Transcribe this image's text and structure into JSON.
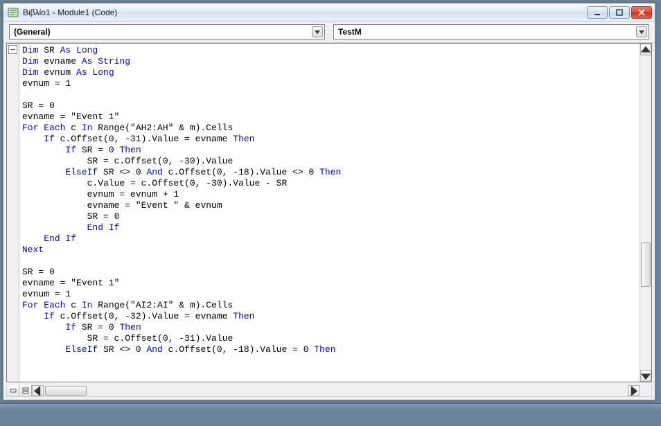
{
  "window": {
    "title": "Βιβλίο1 - Module1 (Code)"
  },
  "dropdowns": {
    "object": "(General)",
    "procedure": "TestM"
  },
  "code_tokens": [
    [
      [
        "kw",
        "Dim"
      ],
      [
        "",
        " SR "
      ],
      [
        "kw",
        "As Long"
      ]
    ],
    [
      [
        "kw",
        "Dim"
      ],
      [
        "",
        " evname "
      ],
      [
        "kw",
        "As String"
      ]
    ],
    [
      [
        "kw",
        "Dim"
      ],
      [
        "",
        " evnum "
      ],
      [
        "kw",
        "As Long"
      ]
    ],
    [
      [
        "",
        "evnum = 1"
      ]
    ],
    [
      [
        "",
        ""
      ]
    ],
    [
      [
        "",
        "SR = 0"
      ]
    ],
    [
      [
        "",
        "evname = \"Event 1\""
      ]
    ],
    [
      [
        "kw",
        "For Each"
      ],
      [
        "",
        " c "
      ],
      [
        "kw",
        "In"
      ],
      [
        "",
        " Range(\"AH2:AH\" & m).Cells"
      ]
    ],
    [
      [
        "",
        "    "
      ],
      [
        "kw",
        "If"
      ],
      [
        "",
        " c.Offset(0, -31).Value = evname "
      ],
      [
        "kw",
        "Then"
      ]
    ],
    [
      [
        "",
        "        "
      ],
      [
        "kw",
        "If"
      ],
      [
        "",
        " SR = 0 "
      ],
      [
        "kw",
        "Then"
      ]
    ],
    [
      [
        "",
        "            SR = c.Offset(0, -30).Value"
      ]
    ],
    [
      [
        "",
        "        "
      ],
      [
        "kw",
        "ElseIf"
      ],
      [
        "",
        " SR <> 0 "
      ],
      [
        "kw",
        "And"
      ],
      [
        "",
        " c.Offset(0, -18).Value <> 0 "
      ],
      [
        "kw",
        "Then"
      ]
    ],
    [
      [
        "",
        "            c.Value = c.Offset(0, -30).Value - SR"
      ]
    ],
    [
      [
        "",
        "            evnum = evnum + 1"
      ]
    ],
    [
      [
        "",
        "            evname = \"Event \" & evnum"
      ]
    ],
    [
      [
        "",
        "            SR = 0"
      ]
    ],
    [
      [
        "",
        "            "
      ],
      [
        "kw",
        "End If"
      ]
    ],
    [
      [
        "",
        "    "
      ],
      [
        "kw",
        "End If"
      ]
    ],
    [
      [
        "kw",
        "Next"
      ]
    ],
    [
      [
        "",
        ""
      ]
    ],
    [
      [
        "",
        "SR = 0"
      ]
    ],
    [
      [
        "",
        "evname = \"Event 1\""
      ]
    ],
    [
      [
        "",
        "evnum = 1"
      ]
    ],
    [
      [
        "kw",
        "For Each"
      ],
      [
        "",
        " c "
      ],
      [
        "kw",
        "In"
      ],
      [
        "",
        " Range(\"AI2:AI\" & m).Cells"
      ]
    ],
    [
      [
        "",
        "    "
      ],
      [
        "kw",
        "If"
      ],
      [
        "",
        " c.Offset(0, -32).Value = evname "
      ],
      [
        "kw",
        "Then"
      ]
    ],
    [
      [
        "",
        "        "
      ],
      [
        "kw",
        "If"
      ],
      [
        "",
        " SR = 0 "
      ],
      [
        "kw",
        "Then"
      ]
    ],
    [
      [
        "",
        "            SR = c.Offset(0, -31).Value"
      ]
    ],
    [
      [
        "",
        "        "
      ],
      [
        "kw",
        "ElseIf"
      ],
      [
        "",
        " SR <> 0 "
      ],
      [
        "kw",
        "And"
      ],
      [
        "",
        " c.Offset(0, -18).Value = 0 "
      ],
      [
        "kw",
        "Then"
      ]
    ]
  ]
}
